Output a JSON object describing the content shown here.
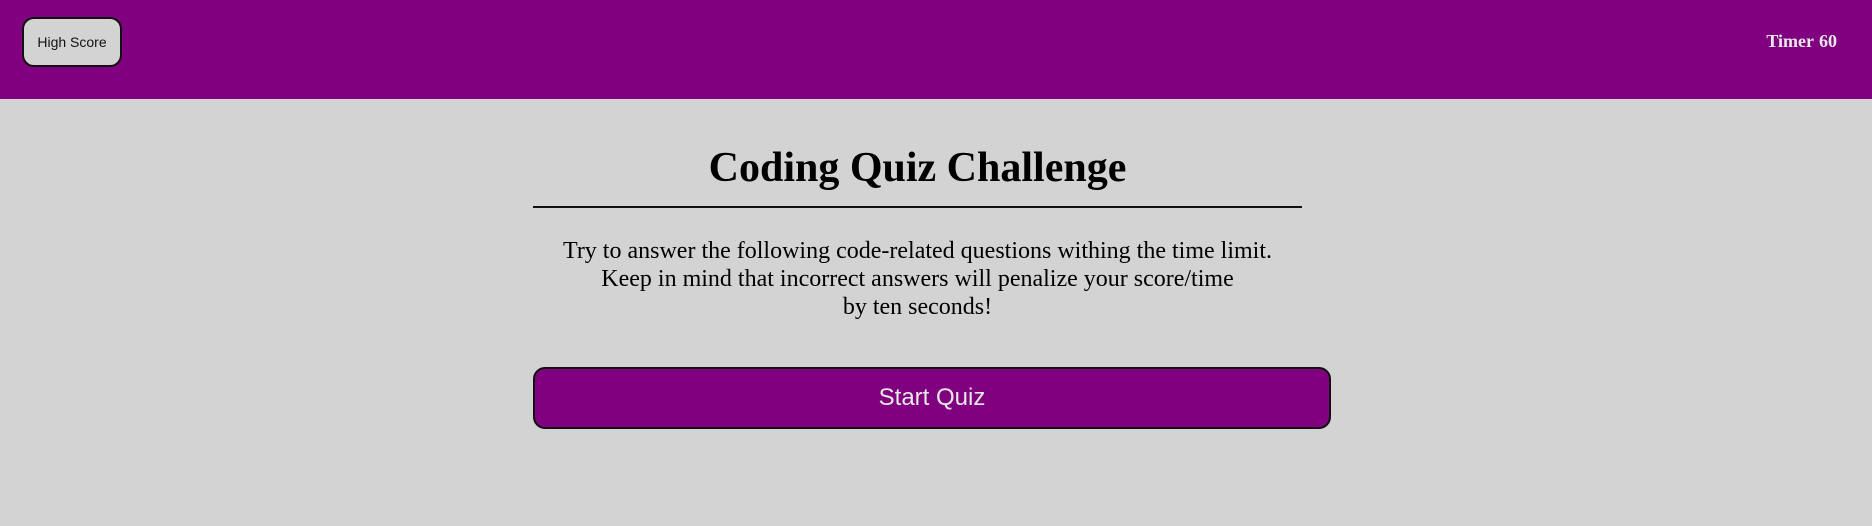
{
  "header": {
    "high_score_label": "High Score",
    "timer_label": "Timer",
    "timer_value": "60"
  },
  "main": {
    "title": "Coding Quiz Challenge",
    "intro_lines": [
      "Try to answer the following code-related questions withing the time limit.",
      "Keep in mind that incorrect answers will penalize your score/time",
      "by ten seconds!"
    ],
    "start_label": "Start Quiz"
  },
  "colors": {
    "header_bg": "#800080",
    "page_bg": "#d3d3d3",
    "button_bg": "#800080",
    "button_text": "#e8e8e8"
  }
}
